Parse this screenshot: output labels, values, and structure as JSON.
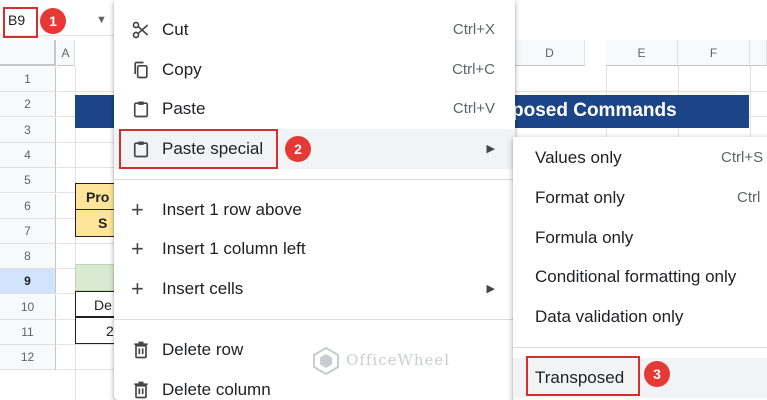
{
  "namebox": {
    "cell_ref": "B9",
    "chevron_icon": "chevron-down-icon"
  },
  "badges": {
    "step1": "1",
    "step2": "2",
    "step3": "3"
  },
  "colors": {
    "badge": "#e53935",
    "highlight": "#d32f2f",
    "title_bar": "#1c4587",
    "header_fill": "#ffe599",
    "green_fill": "#d9ead3"
  },
  "columns": [
    "A",
    "D",
    "E",
    "F"
  ],
  "rows": [
    "1",
    "2",
    "3",
    "4",
    "5",
    "6",
    "7",
    "8",
    "9",
    "10",
    "11",
    "12"
  ],
  "sheet": {
    "title_text": "posed Commands",
    "row5_cell": "Pro",
    "row6_cell": "S",
    "row9_cell": "De",
    "row10_cell": "2"
  },
  "context_menu": {
    "items": [
      {
        "label": "Cut",
        "shortcut": "Ctrl+X",
        "icon": "scissors-icon"
      },
      {
        "label": "Copy",
        "shortcut": "Ctrl+C",
        "icon": "copy-icon"
      },
      {
        "label": "Paste",
        "shortcut": "Ctrl+V",
        "icon": "clipboard-icon"
      },
      {
        "label": "Paste special",
        "icon": "clipboard-icon",
        "submenu_icon": "caret-right-icon"
      },
      {
        "label": "Insert 1 row above",
        "icon": "plus-icon"
      },
      {
        "label": "Insert 1 column left",
        "icon": "plus-icon"
      },
      {
        "label": "Insert cells",
        "icon": "plus-icon",
        "submenu_icon": "caret-right-icon"
      },
      {
        "label": "Delete row",
        "icon": "trash-icon"
      },
      {
        "label": "Delete column",
        "icon": "trash-icon"
      }
    ]
  },
  "paste_special_menu": {
    "items": [
      {
        "label": "Values only",
        "shortcut": "Ctrl+S"
      },
      {
        "label": "Format only",
        "shortcut": "Ctrl"
      },
      {
        "label": "Formula only"
      },
      {
        "label": "Conditional formatting only"
      },
      {
        "label": "Data validation only"
      },
      {
        "label": "Transposed"
      }
    ]
  },
  "watermark": {
    "text": "OfficeWheel",
    "icon": "officewheel-logo-icon"
  }
}
